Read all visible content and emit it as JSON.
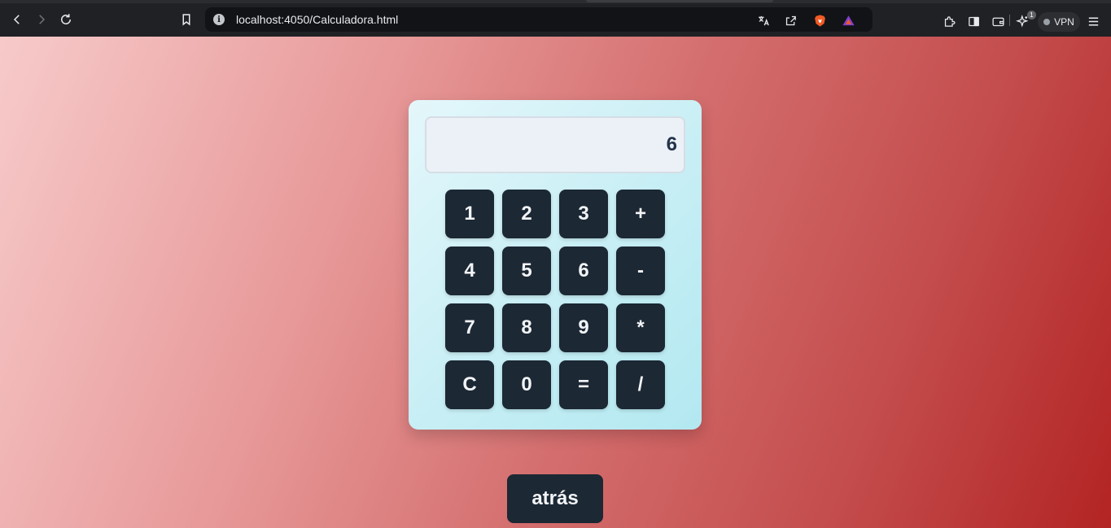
{
  "browser": {
    "url": "localhost:4050/Calculadora.html",
    "extension_badge_count": "1",
    "vpn_label": "VPN"
  },
  "calculator": {
    "display_value": "6",
    "keys": [
      {
        "label": "1",
        "name": "key-1"
      },
      {
        "label": "2",
        "name": "key-2"
      },
      {
        "label": "3",
        "name": "key-3"
      },
      {
        "label": "+",
        "name": "key-plus"
      },
      {
        "label": "4",
        "name": "key-4"
      },
      {
        "label": "5",
        "name": "key-5"
      },
      {
        "label": "6",
        "name": "key-6"
      },
      {
        "label": "-",
        "name": "key-minus"
      },
      {
        "label": "7",
        "name": "key-7"
      },
      {
        "label": "8",
        "name": "key-8"
      },
      {
        "label": "9",
        "name": "key-9"
      },
      {
        "label": "*",
        "name": "key-multiply"
      },
      {
        "label": "C",
        "name": "key-clear"
      },
      {
        "label": "0",
        "name": "key-0"
      },
      {
        "label": "=",
        "name": "key-equals"
      },
      {
        "label": "/",
        "name": "key-divide"
      }
    ]
  },
  "back_button": {
    "label": "atrás"
  },
  "colors": {
    "key_bg": "#1c2834",
    "display_text": "#24334a",
    "gradient_start": "#f7caca",
    "gradient_end": "#b32424"
  }
}
